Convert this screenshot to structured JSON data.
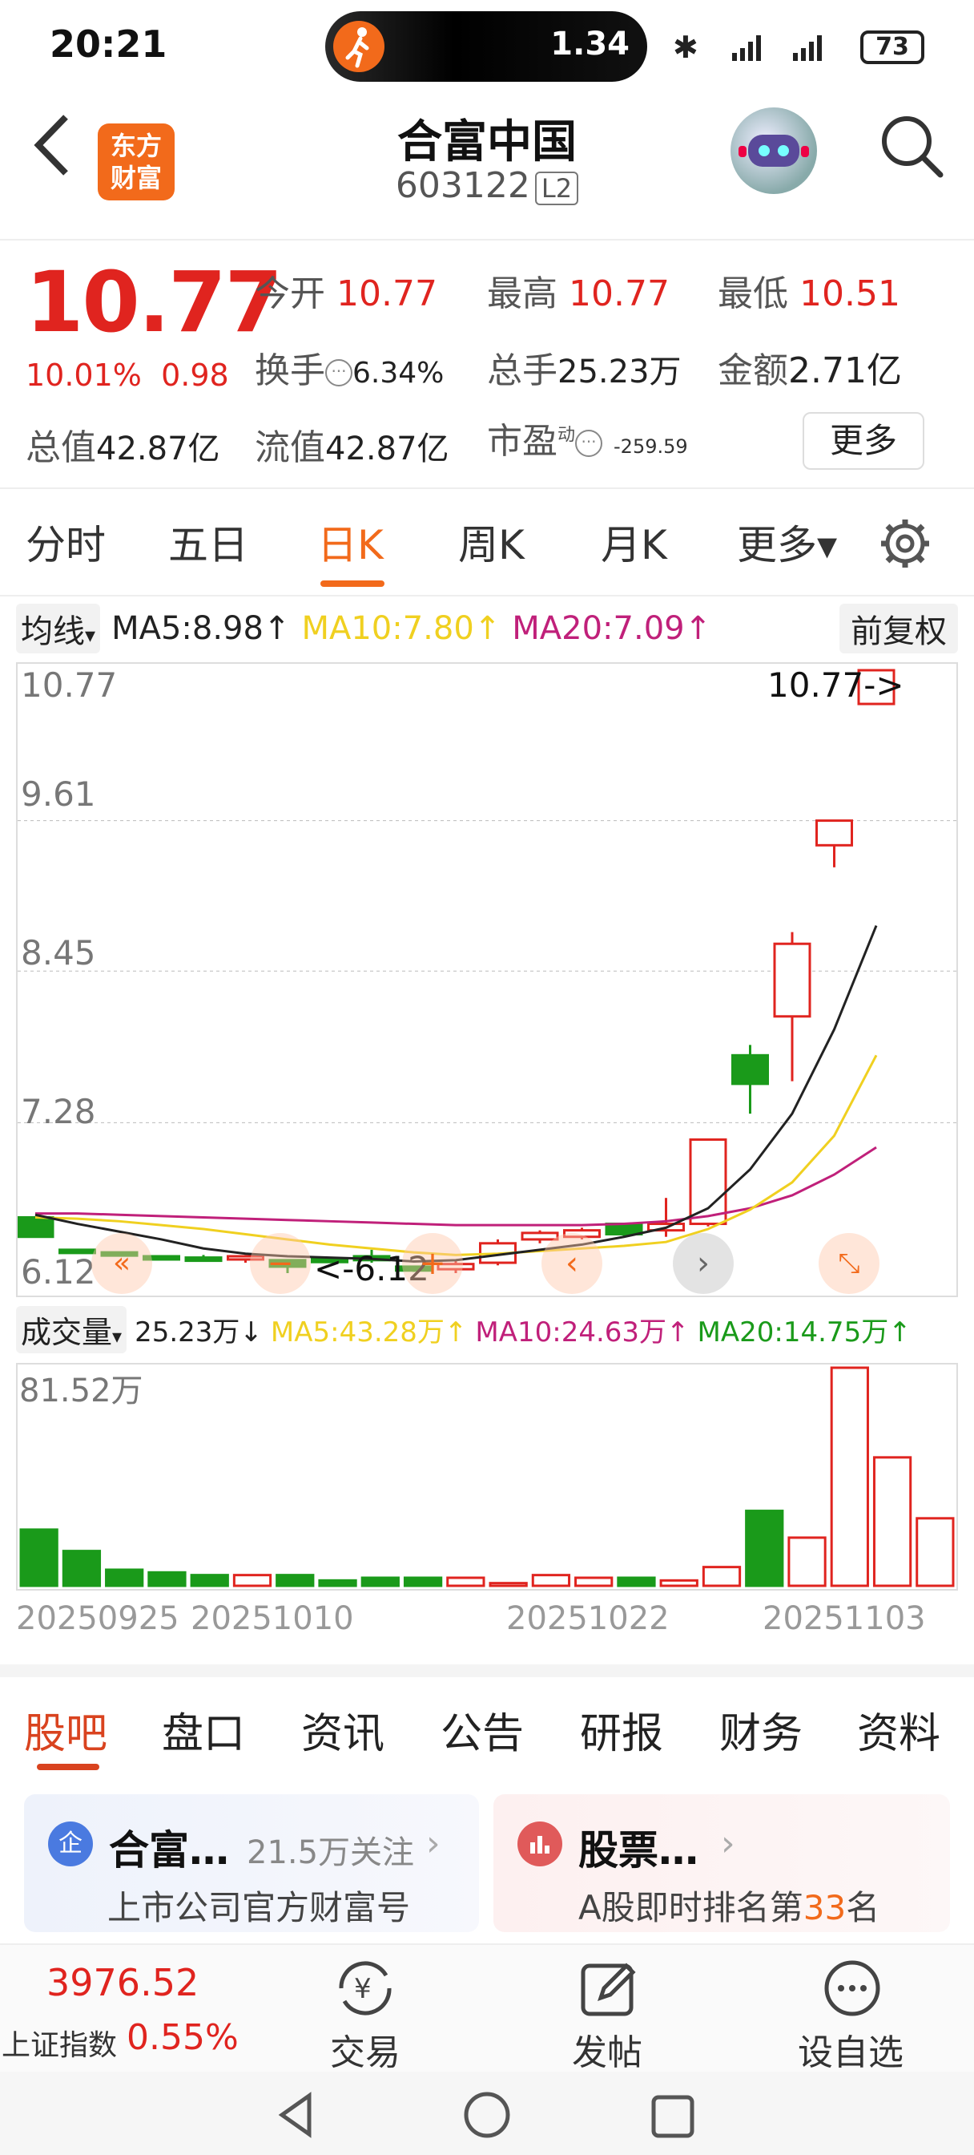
{
  "status": {
    "time": "20:21",
    "speed": "1.34",
    "battery": "73"
  },
  "header": {
    "logo_line1": "东方",
    "logo_line2": "财富",
    "title": "合富中国",
    "code": "603122",
    "badge": "L2"
  },
  "quote": {
    "price": "10.77",
    "change_pct": "10.01%",
    "change": "0.98",
    "open_label": "今开",
    "open": "10.77",
    "high_label": "最高",
    "high": "10.77",
    "low_label": "最低",
    "low": "10.51",
    "turnover_label": "换手",
    "turnover": "6.34%",
    "volume_label": "总手",
    "volume": "25.23万",
    "amount_label": "金额",
    "amount": "2.71亿",
    "mcap_label": "总值",
    "mcap": "42.87亿",
    "float_label": "流值",
    "float": "42.87亿",
    "pe_label": "市盈",
    "pe_sup": "动",
    "pe": "-259.59",
    "more": "更多"
  },
  "tabs": [
    "分时",
    "五日",
    "日K",
    "周K",
    "月K",
    "更多▾"
  ],
  "ma": {
    "selector": "均线",
    "ma5": "MA5:8.98↑",
    "ma10": "MA10:7.80↑",
    "ma20": "MA20:7.09↑",
    "adjust": "前复权"
  },
  "colors": {
    "up": "#e0241f",
    "down": "#1a9a1a",
    "ma5": "#222222",
    "ma10": "#f0d020",
    "ma20": "#c0207a",
    "accent": "#f26a1b"
  },
  "kchart": {
    "y_labels": [
      "10.77",
      "9.61",
      "8.45",
      "7.28",
      "6.12"
    ],
    "max_label": "10.77->",
    "min_label": "<-6.12"
  },
  "vol": {
    "selector": "成交量",
    "current": "25.23万↓",
    "ma5": "MA5:43.28万↑",
    "ma10": "MA10:24.63万↑",
    "ma20": "MA20:14.75万↑",
    "max_label": "81.52万"
  },
  "dates": [
    "20250925",
    "20251010",
    "20251022",
    "20251103"
  ],
  "bottom_tabs": [
    "股吧",
    "盘口",
    "资讯",
    "公告",
    "研报",
    "财务",
    "资料"
  ],
  "cards": [
    {
      "icon": "企",
      "title": "合富…",
      "sub": "21.5万关注",
      "desc": "上市公司官方财富号"
    },
    {
      "title": "股票…",
      "desc_pre": "A股即时排名第",
      "rank": "33",
      "desc_post": "名"
    }
  ],
  "nav": {
    "index_value": "3976.52",
    "index_name": "上证指数",
    "index_change": "0.55%",
    "trade": "交易",
    "post": "发帖",
    "watch": "设自选"
  },
  "chart_data": {
    "type": "candlestick",
    "ohlc": [
      {
        "o": 6.55,
        "h": 6.55,
        "l": 6.4,
        "c": 6.4
      },
      {
        "o": 6.3,
        "h": 6.3,
        "l": 6.28,
        "c": 6.29
      },
      {
        "o": 6.28,
        "h": 6.28,
        "l": 6.26,
        "c": 6.27
      },
      {
        "o": 6.25,
        "h": 6.25,
        "l": 6.23,
        "c": 6.24
      },
      {
        "o": 6.24,
        "h": 6.26,
        "l": 6.22,
        "c": 6.23
      },
      {
        "o": 6.25,
        "h": 6.26,
        "l": 6.2,
        "c": 6.25
      },
      {
        "o": 6.22,
        "h": 6.22,
        "l": 6.12,
        "c": 6.17
      },
      {
        "o": 6.23,
        "h": 6.23,
        "l": 6.2,
        "c": 6.21
      },
      {
        "o": 6.25,
        "h": 6.3,
        "l": 6.2,
        "c": 6.22
      },
      {
        "o": 6.17,
        "h": 6.17,
        "l": 6.13,
        "c": 6.14
      },
      {
        "o": 6.15,
        "h": 6.22,
        "l": 6.12,
        "c": 6.19
      },
      {
        "o": 6.2,
        "h": 6.38,
        "l": 6.18,
        "c": 6.35
      },
      {
        "o": 6.38,
        "h": 6.45,
        "l": 6.35,
        "c": 6.43
      },
      {
        "o": 6.4,
        "h": 6.47,
        "l": 6.38,
        "c": 6.45
      },
      {
        "o": 6.5,
        "h": 6.5,
        "l": 6.4,
        "c": 6.42
      },
      {
        "o": 6.45,
        "h": 6.7,
        "l": 6.4,
        "c": 6.5
      },
      {
        "o": 6.5,
        "h": 7.1,
        "l": 6.48,
        "c": 7.15
      },
      {
        "o": 7.8,
        "h": 7.88,
        "l": 7.35,
        "c": 7.58
      },
      {
        "o": 8.1,
        "h": 8.75,
        "l": 7.6,
        "c": 8.66
      },
      {
        "o": 9.42,
        "h": 9.61,
        "l": 9.25,
        "c": 9.61
      },
      {
        "o": 10.51,
        "h": 10.77,
        "l": 10.51,
        "c": 10.77
      }
    ],
    "ma5": [
      6.57,
      6.5,
      6.44,
      6.38,
      6.31,
      6.27,
      6.25,
      6.24,
      6.23,
      6.21,
      6.22,
      6.26,
      6.3,
      6.34,
      6.4,
      6.47,
      6.62,
      6.92,
      7.35,
      8.0,
      8.8
    ],
    "ma10": [
      6.55,
      6.54,
      6.52,
      6.49,
      6.46,
      6.42,
      6.38,
      6.34,
      6.31,
      6.28,
      6.26,
      6.27,
      6.29,
      6.31,
      6.33,
      6.36,
      6.46,
      6.61,
      6.82,
      7.18,
      7.8
    ],
    "ma20": [
      6.58,
      6.58,
      6.57,
      6.56,
      6.55,
      6.54,
      6.53,
      6.52,
      6.51,
      6.5,
      6.49,
      6.49,
      6.49,
      6.49,
      6.5,
      6.52,
      6.56,
      6.62,
      6.72,
      6.88,
      7.09
    ],
    "volume": [
      21,
      13,
      6,
      5,
      4,
      4,
      4,
      2,
      3,
      3,
      3,
      1,
      4,
      3,
      3,
      2,
      7,
      28,
      18,
      81.52,
      48,
      25.23
    ],
    "y_range": [
      6.12,
      10.77
    ]
  }
}
